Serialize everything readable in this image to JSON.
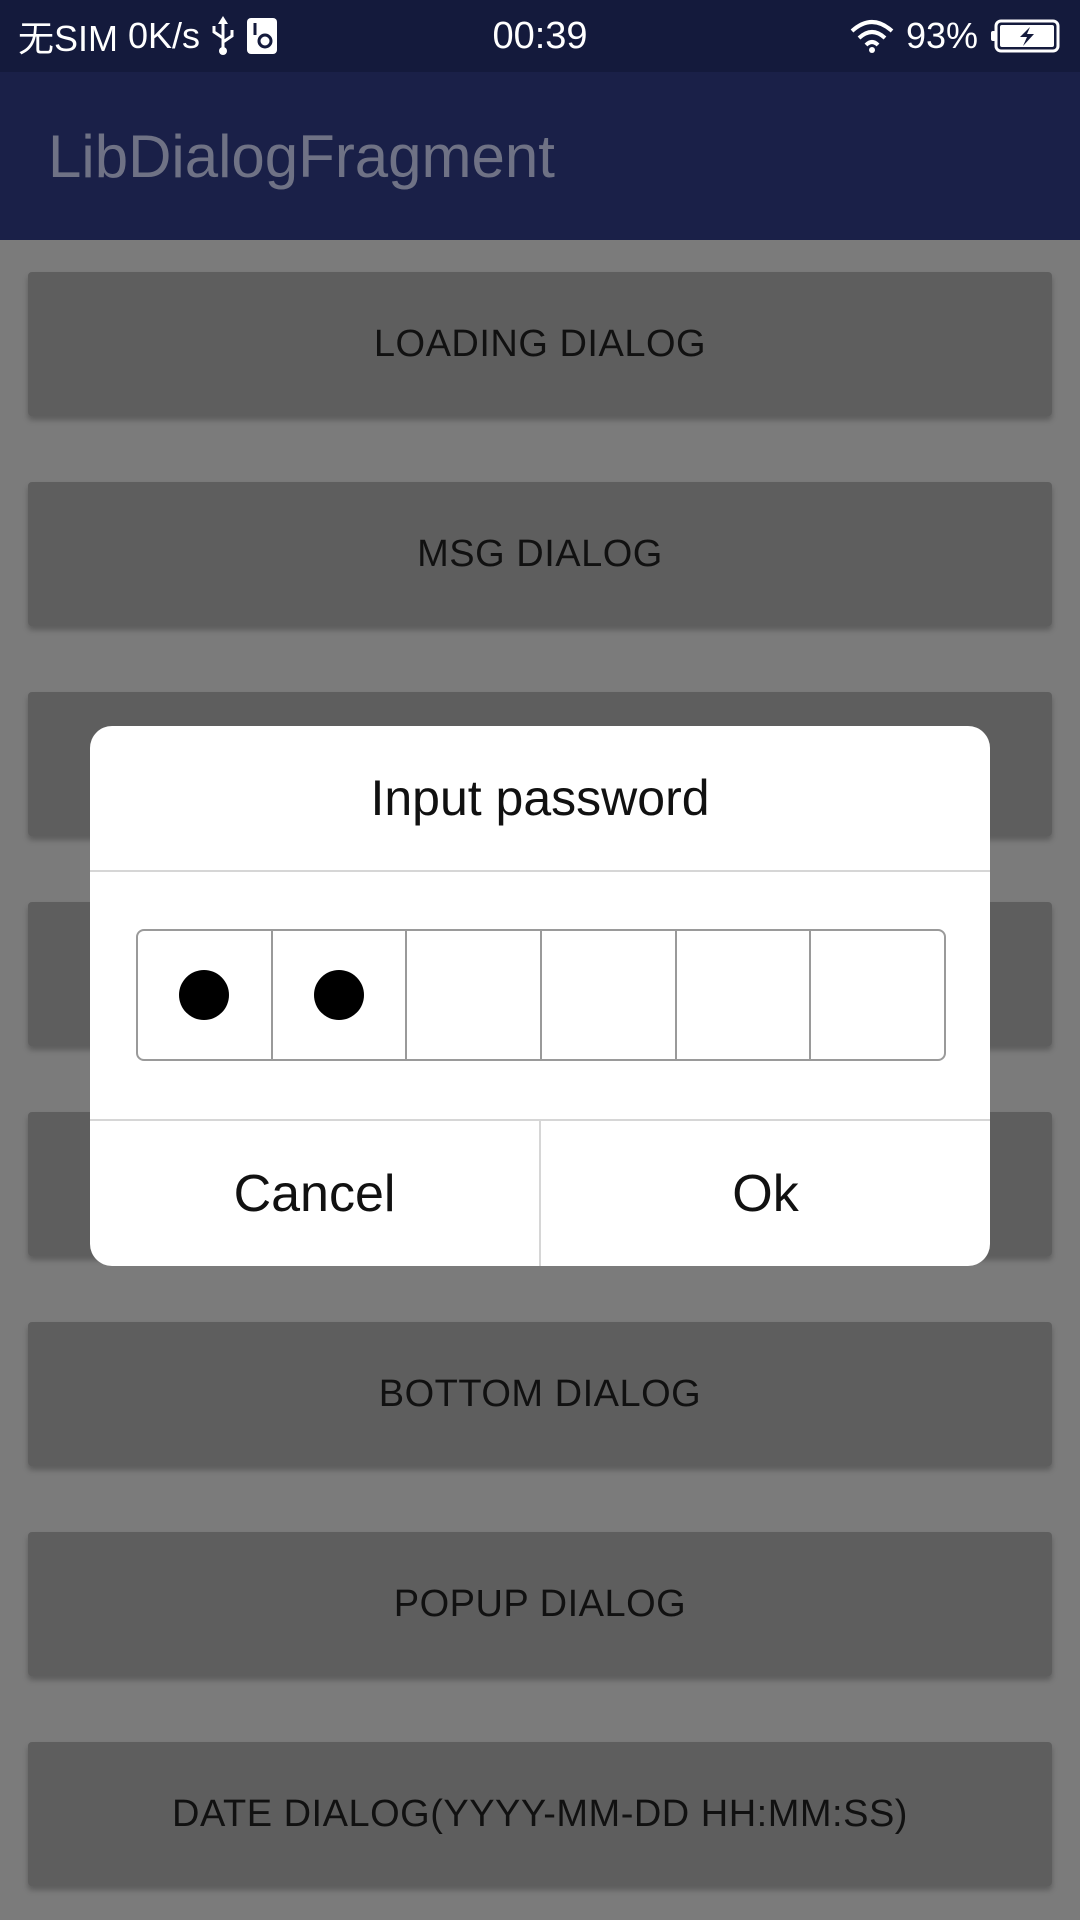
{
  "status_bar": {
    "carrier": "无SIM",
    "speed": "0K/s",
    "time": "00:39",
    "battery": "93%",
    "icons": [
      "usb-icon",
      "settings-chip-icon",
      "wifi-icon",
      "battery-icon"
    ]
  },
  "app_bar": {
    "title": "LibDialogFragment"
  },
  "list": {
    "buttons": [
      "LOADING DIALOG",
      "MSG DIALOG",
      "",
      "",
      "",
      "BOTTOM DIALOG",
      "POPUP DIALOG",
      "DATE DIALOG(YYYY-MM-DD HH:MM:SS)"
    ]
  },
  "dialog": {
    "title": "Input password",
    "password_length": 6,
    "entered_count": 2,
    "cancel_label": "Cancel",
    "ok_label": "Ok"
  },
  "colors": {
    "status_bar_bg": "#141a3c",
    "app_bar_bg": "#1a2048",
    "scrim_bg": "#7b7b7b",
    "list_button_bg": "#5e5e5e",
    "dialog_bg": "#ffffff"
  }
}
